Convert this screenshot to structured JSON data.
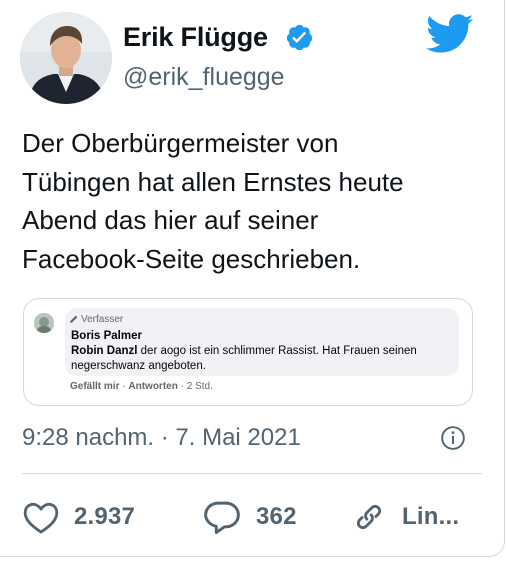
{
  "author": {
    "name": "Erik Flügge",
    "handle": "@erik_fluegge"
  },
  "tweet": {
    "text": "Der Oberbürgermeister von\nTübingen hat allen Ernstes heute\nAbend das hier auf seiner\nFacebook-Seite geschrieben."
  },
  "embedded_comment": {
    "tag": "Verfasser",
    "author": "Boris Palmer",
    "reply_author": "Robin Danzl",
    "reply_text": " der aogo ist ein schlimmer Rassist. Hat Frauen seinen negerschwanz angeboten.",
    "like_label": "Gefällt mir",
    "separator": "·",
    "reply_label": "Antworten",
    "time": "2 Std."
  },
  "meta": {
    "timestamp": "9:28 nachm. · 7. Mai 2021"
  },
  "actions": {
    "likes": "2.937",
    "replies": "362",
    "link_label": "Lin..."
  },
  "colors": {
    "twitter_blue": "#1d9bf0",
    "secondary_text": "#536471",
    "border": "#cfd9de",
    "fb_bubble": "#f0f2f5"
  },
  "icons": [
    "avatar",
    "verified-badge-icon",
    "twitter-bird-icon",
    "info-icon",
    "heart-icon",
    "reply-bubble-icon",
    "link-icon",
    "pencil-icon"
  ]
}
